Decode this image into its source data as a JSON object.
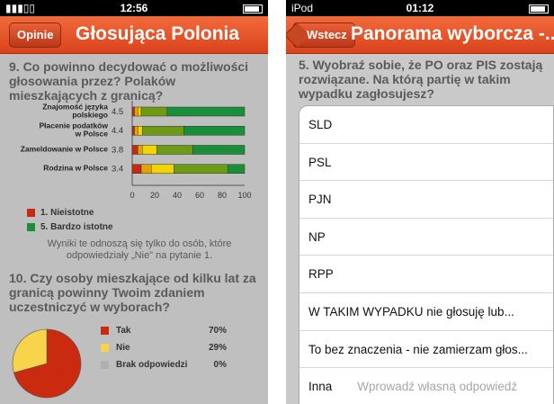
{
  "left": {
    "status": {
      "carrier": "▮▮▮▯▯",
      "time": "12:56",
      "icons": "✱ ◎ ▮"
    },
    "nav": {
      "button": "Opinie",
      "title": "Głosująca Polonia"
    },
    "q9": {
      "text": "9. Co powinno decydować o możliwości głosowania przez? Polaków mieszkających z granicą?",
      "chart_data": {
        "type": "bar",
        "stacked": true,
        "categories": [
          "Znajomość języka polskiego",
          "Płacenie podatków w Polsce",
          "Zameldowanie w Polsce",
          "Rodzina w Polsce"
        ],
        "scores": [
          "4.5",
          "4.4",
          "3.8",
          "3.4"
        ],
        "segments": [
          [
            2,
            3,
            3,
            23,
            69
          ],
          [
            2,
            3,
            4,
            37,
            54
          ],
          [
            5,
            4,
            13,
            32,
            46
          ],
          [
            8,
            9,
            20,
            48,
            15
          ]
        ],
        "segment_colors": [
          "#c62a12",
          "#e1a300",
          "#f4d400",
          "#6f9a16",
          "#1a8f3a"
        ],
        "xlim": [
          0,
          100
        ],
        "xticks": [
          "0",
          "20",
          "40",
          "60",
          "80",
          "100"
        ]
      },
      "legend": [
        {
          "label": "1.  Nieistotne",
          "color": "#c62a12"
        },
        {
          "label": "5.  Bardzo istotne",
          "color": "#1a8f3a"
        }
      ],
      "note": "Wyniki te odnoszą się tylko do osób, które odpowiedziały „Nie\" na pytanie 1."
    },
    "q10": {
      "text": "10. Czy osoby mieszkające od kilku lat za granicą powinny Twoim zdaniem uczestniczyć w wyborach?",
      "chart_data": {
        "type": "pie",
        "labels": [
          "Tak",
          "Nie",
          "Brak odpowiedzi"
        ],
        "values": [
          70,
          29,
          0
        ],
        "pcts": [
          "70%",
          "29%",
          "0%"
        ],
        "colors": [
          "#c92a10",
          "#f7d44a",
          "#b0b0b0"
        ]
      }
    }
  },
  "right": {
    "status": {
      "carrier": "iPod",
      "time": "01:12",
      "icons": "▮"
    },
    "nav": {
      "back": "Wstecz",
      "title": "Panorama wyborcza -..."
    },
    "q5": {
      "text": "5. Wyobraź sobie, że PO oraz PIS zostają rozwiązane. Na którą partię w takim wypadku zagłosujesz?"
    },
    "options": [
      "SLD",
      "PSL",
      "PJN",
      "NP",
      "RPP",
      "W TAKIM WYPADKU nie głosuję lub...",
      "To bez znaczenia - nie zamierzam głos..."
    ],
    "other": {
      "label": "Inna",
      "placeholder": "Wprowadź własną odpowiedź"
    }
  }
}
